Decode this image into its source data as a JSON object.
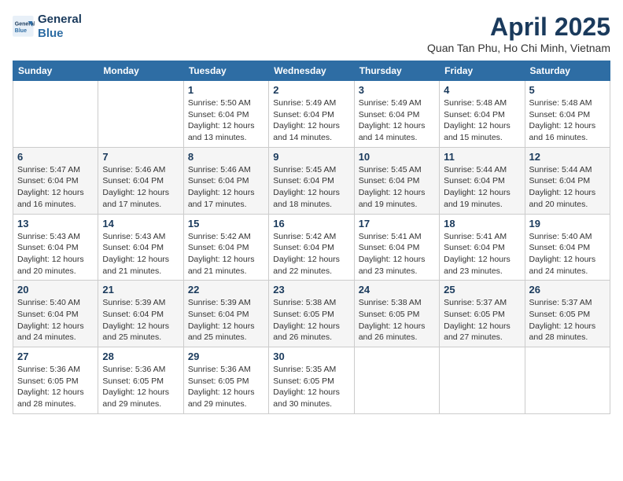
{
  "logo": {
    "line1": "General",
    "line2": "Blue"
  },
  "title": "April 2025",
  "subtitle": "Quan Tan Phu, Ho Chi Minh, Vietnam",
  "days_of_week": [
    "Sunday",
    "Monday",
    "Tuesday",
    "Wednesday",
    "Thursday",
    "Friday",
    "Saturday"
  ],
  "weeks": [
    [
      {
        "day": "",
        "lines": []
      },
      {
        "day": "",
        "lines": []
      },
      {
        "day": "1",
        "lines": [
          "Sunrise: 5:50 AM",
          "Sunset: 6:04 PM",
          "Daylight: 12 hours",
          "and 13 minutes."
        ]
      },
      {
        "day": "2",
        "lines": [
          "Sunrise: 5:49 AM",
          "Sunset: 6:04 PM",
          "Daylight: 12 hours",
          "and 14 minutes."
        ]
      },
      {
        "day": "3",
        "lines": [
          "Sunrise: 5:49 AM",
          "Sunset: 6:04 PM",
          "Daylight: 12 hours",
          "and 14 minutes."
        ]
      },
      {
        "day": "4",
        "lines": [
          "Sunrise: 5:48 AM",
          "Sunset: 6:04 PM",
          "Daylight: 12 hours",
          "and 15 minutes."
        ]
      },
      {
        "day": "5",
        "lines": [
          "Sunrise: 5:48 AM",
          "Sunset: 6:04 PM",
          "Daylight: 12 hours",
          "and 16 minutes."
        ]
      }
    ],
    [
      {
        "day": "6",
        "lines": [
          "Sunrise: 5:47 AM",
          "Sunset: 6:04 PM",
          "Daylight: 12 hours",
          "and 16 minutes."
        ]
      },
      {
        "day": "7",
        "lines": [
          "Sunrise: 5:46 AM",
          "Sunset: 6:04 PM",
          "Daylight: 12 hours",
          "and 17 minutes."
        ]
      },
      {
        "day": "8",
        "lines": [
          "Sunrise: 5:46 AM",
          "Sunset: 6:04 PM",
          "Daylight: 12 hours",
          "and 17 minutes."
        ]
      },
      {
        "day": "9",
        "lines": [
          "Sunrise: 5:45 AM",
          "Sunset: 6:04 PM",
          "Daylight: 12 hours",
          "and 18 minutes."
        ]
      },
      {
        "day": "10",
        "lines": [
          "Sunrise: 5:45 AM",
          "Sunset: 6:04 PM",
          "Daylight: 12 hours",
          "and 19 minutes."
        ]
      },
      {
        "day": "11",
        "lines": [
          "Sunrise: 5:44 AM",
          "Sunset: 6:04 PM",
          "Daylight: 12 hours",
          "and 19 minutes."
        ]
      },
      {
        "day": "12",
        "lines": [
          "Sunrise: 5:44 AM",
          "Sunset: 6:04 PM",
          "Daylight: 12 hours",
          "and 20 minutes."
        ]
      }
    ],
    [
      {
        "day": "13",
        "lines": [
          "Sunrise: 5:43 AM",
          "Sunset: 6:04 PM",
          "Daylight: 12 hours",
          "and 20 minutes."
        ]
      },
      {
        "day": "14",
        "lines": [
          "Sunrise: 5:43 AM",
          "Sunset: 6:04 PM",
          "Daylight: 12 hours",
          "and 21 minutes."
        ]
      },
      {
        "day": "15",
        "lines": [
          "Sunrise: 5:42 AM",
          "Sunset: 6:04 PM",
          "Daylight: 12 hours",
          "and 21 minutes."
        ]
      },
      {
        "day": "16",
        "lines": [
          "Sunrise: 5:42 AM",
          "Sunset: 6:04 PM",
          "Daylight: 12 hours",
          "and 22 minutes."
        ]
      },
      {
        "day": "17",
        "lines": [
          "Sunrise: 5:41 AM",
          "Sunset: 6:04 PM",
          "Daylight: 12 hours",
          "and 23 minutes."
        ]
      },
      {
        "day": "18",
        "lines": [
          "Sunrise: 5:41 AM",
          "Sunset: 6:04 PM",
          "Daylight: 12 hours",
          "and 23 minutes."
        ]
      },
      {
        "day": "19",
        "lines": [
          "Sunrise: 5:40 AM",
          "Sunset: 6:04 PM",
          "Daylight: 12 hours",
          "and 24 minutes."
        ]
      }
    ],
    [
      {
        "day": "20",
        "lines": [
          "Sunrise: 5:40 AM",
          "Sunset: 6:04 PM",
          "Daylight: 12 hours",
          "and 24 minutes."
        ]
      },
      {
        "day": "21",
        "lines": [
          "Sunrise: 5:39 AM",
          "Sunset: 6:04 PM",
          "Daylight: 12 hours",
          "and 25 minutes."
        ]
      },
      {
        "day": "22",
        "lines": [
          "Sunrise: 5:39 AM",
          "Sunset: 6:04 PM",
          "Daylight: 12 hours",
          "and 25 minutes."
        ]
      },
      {
        "day": "23",
        "lines": [
          "Sunrise: 5:38 AM",
          "Sunset: 6:05 PM",
          "Daylight: 12 hours",
          "and 26 minutes."
        ]
      },
      {
        "day": "24",
        "lines": [
          "Sunrise: 5:38 AM",
          "Sunset: 6:05 PM",
          "Daylight: 12 hours",
          "and 26 minutes."
        ]
      },
      {
        "day": "25",
        "lines": [
          "Sunrise: 5:37 AM",
          "Sunset: 6:05 PM",
          "Daylight: 12 hours",
          "and 27 minutes."
        ]
      },
      {
        "day": "26",
        "lines": [
          "Sunrise: 5:37 AM",
          "Sunset: 6:05 PM",
          "Daylight: 12 hours",
          "and 28 minutes."
        ]
      }
    ],
    [
      {
        "day": "27",
        "lines": [
          "Sunrise: 5:36 AM",
          "Sunset: 6:05 PM",
          "Daylight: 12 hours",
          "and 28 minutes."
        ]
      },
      {
        "day": "28",
        "lines": [
          "Sunrise: 5:36 AM",
          "Sunset: 6:05 PM",
          "Daylight: 12 hours",
          "and 29 minutes."
        ]
      },
      {
        "day": "29",
        "lines": [
          "Sunrise: 5:36 AM",
          "Sunset: 6:05 PM",
          "Daylight: 12 hours",
          "and 29 minutes."
        ]
      },
      {
        "day": "30",
        "lines": [
          "Sunrise: 5:35 AM",
          "Sunset: 6:05 PM",
          "Daylight: 12 hours",
          "and 30 minutes."
        ]
      },
      {
        "day": "",
        "lines": []
      },
      {
        "day": "",
        "lines": []
      },
      {
        "day": "",
        "lines": []
      }
    ]
  ]
}
